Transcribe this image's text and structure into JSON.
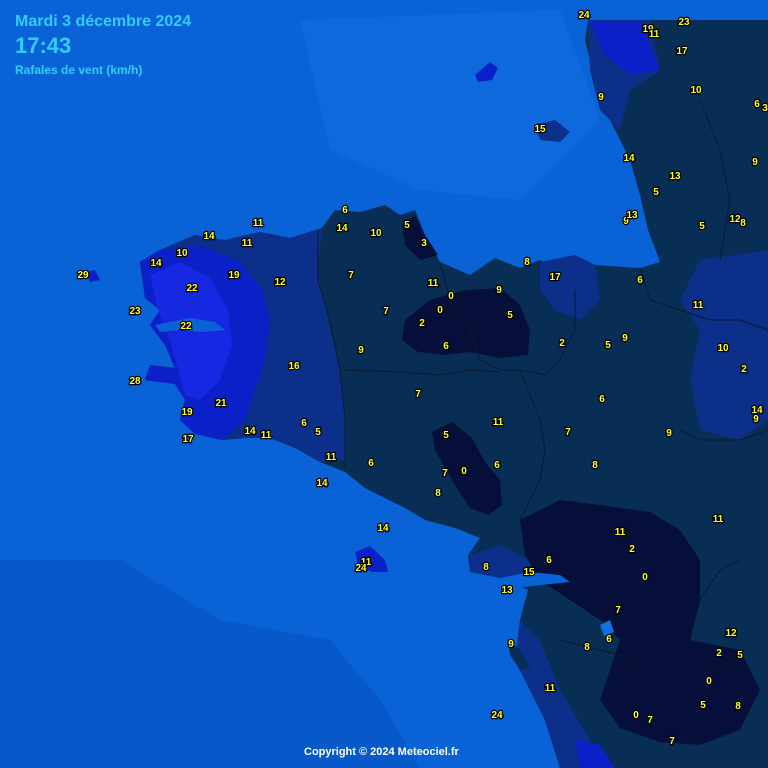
{
  "header": {
    "date": "Mardi 3 décembre 2024",
    "time": "17:43",
    "subtitle": "Rafales de vent (km/h)"
  },
  "footer": {
    "copyright": "Copyright © 2024 Meteociel.fr"
  },
  "colors": {
    "sea": "#0a63d6",
    "land_low": "#082e55",
    "land_calm": "#050f3a",
    "land_medium": "#0c2f8a",
    "land_high": "#0c20c8",
    "label_text": "#ffff33",
    "header_text": "#33ccff"
  },
  "wind_gusts_kmh": [
    "24",
    "19",
    "11",
    "23",
    "17",
    "9",
    "10",
    "6",
    "3",
    "15",
    "14",
    "9",
    "5",
    "13",
    "12",
    "8",
    "9",
    "13",
    "5",
    "6",
    "14",
    "10",
    "3",
    "5",
    "11",
    "14",
    "11",
    "29",
    "10",
    "14",
    "19",
    "12",
    "22",
    "23",
    "22",
    "7",
    "11",
    "0",
    "9",
    "0",
    "8",
    "17",
    "7",
    "2",
    "5",
    "6",
    "6",
    "2",
    "5",
    "9",
    "9",
    "11",
    "10",
    "28",
    "16",
    "7",
    "2",
    "21",
    "19",
    "6",
    "5",
    "14",
    "11",
    "17",
    "14",
    "11",
    "9",
    "7",
    "6",
    "11",
    "5",
    "9",
    "7",
    "0",
    "6",
    "8",
    "6",
    "14",
    "8",
    "11",
    "14",
    "15",
    "11",
    "2",
    "6",
    "0",
    "11",
    "24",
    "8",
    "13",
    "7",
    "9",
    "6",
    "8",
    "12",
    "2",
    "5",
    "0",
    "11",
    "5",
    "8",
    "24",
    "0",
    "7",
    "7"
  ]
}
